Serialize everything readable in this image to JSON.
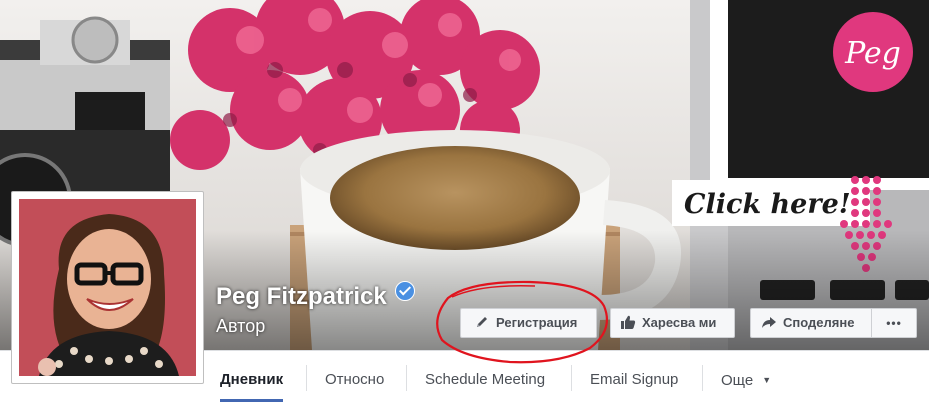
{
  "page": {
    "name": "Peg Fitzpatrick",
    "category": "Автор"
  },
  "cover": {
    "logo_text": "Peg",
    "handwriting": "Click here!",
    "accent_color": "#e0387e"
  },
  "actions": {
    "signup_label": "Регистрация",
    "like_label": "Харесва ми",
    "share_label": "Споделяне",
    "more_label": "•••"
  },
  "tabs": [
    {
      "label": "Дневник",
      "active": true
    },
    {
      "label": "Относно"
    },
    {
      "label": "Schedule Meeting"
    },
    {
      "label": "Email Signup"
    },
    {
      "label": "Още"
    }
  ],
  "colors": {
    "link_blue": "#4267b2",
    "verified_blue": "#4a90e2",
    "annotation_red": "#e0141e"
  }
}
